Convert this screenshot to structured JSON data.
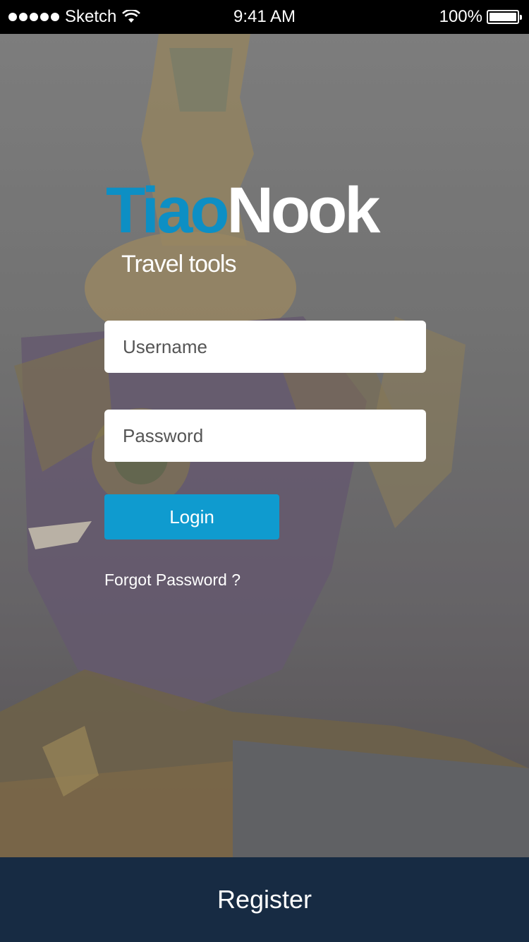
{
  "status_bar": {
    "carrier": "Sketch",
    "time": "9:41 AM",
    "battery": "100%",
    "icons": [
      "signal-dots-icon",
      "wifi-icon",
      "battery-icon"
    ]
  },
  "logo": {
    "part1": "Tiao",
    "part2": "Nook",
    "part1_color": "#0d8fc4",
    "part2_color": "#ffffff"
  },
  "tagline": "Travel tools",
  "form": {
    "username_placeholder": "Username",
    "username_value": "",
    "password_placeholder": "Password",
    "password_value": "",
    "login_label": "Login",
    "forgot_label": "Forgot Password ?"
  },
  "footer": {
    "register_label": "Register"
  },
  "colors": {
    "accent": "#0f9bcf",
    "footer_bg": "#172b43"
  }
}
